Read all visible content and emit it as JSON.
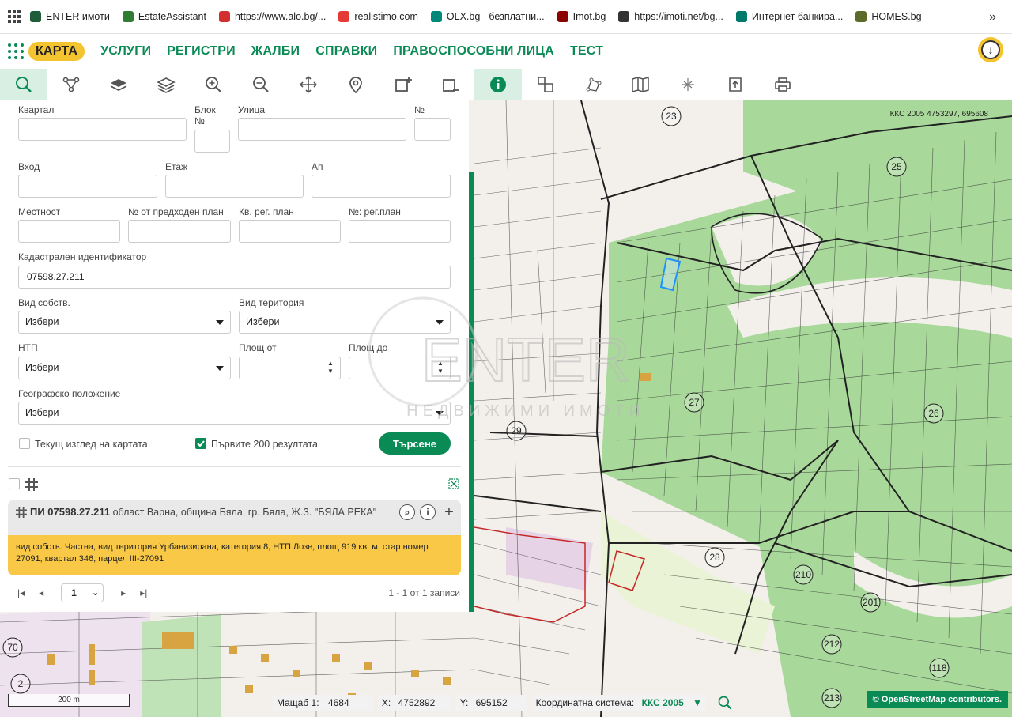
{
  "bookmarks": [
    {
      "label": "ENTER имоти",
      "color": "#1f5c3a",
      "icon": "enter-icon"
    },
    {
      "label": "EstateAssistant",
      "color": "#2e7d32",
      "icon": "estate-icon"
    },
    {
      "label": "https://www.alo.bg/...",
      "color": "#d32f2f",
      "icon": "alo-icon"
    },
    {
      "label": "realistimo.com",
      "color": "#e53935",
      "icon": "realistimo-icon"
    },
    {
      "label": "OLX.bg - безплатни...",
      "color": "#00897b",
      "icon": "olx-icon"
    },
    {
      "label": "Imot.bg",
      "color": "#8b0000",
      "icon": "imot-icon"
    },
    {
      "label": "https://imoti.net/bg...",
      "color": "#333333",
      "icon": "globe-icon"
    },
    {
      "label": "Интернет банкира...",
      "color": "#00796b",
      "icon": "bank-icon"
    },
    {
      "label": "HOMES.bg",
      "color": "#5d6b2a",
      "icon": "homes-icon"
    }
  ],
  "nav": {
    "items": [
      "КАРТА",
      "УСЛУГИ",
      "РЕГИСТРИ",
      "ЖАЛБИ",
      "СПРАВКИ",
      "ПРАВОСПОСОБНИ ЛИЦА",
      "ТЕСТ"
    ],
    "active": "КАРТА"
  },
  "toolbar": [
    "search-icon",
    "route-icon",
    "layers-icon",
    "layers-stack-icon",
    "zoom-in-icon",
    "zoom-out-icon",
    "pan-icon",
    "location-pin-icon",
    "add-area-icon",
    "remove-area-icon",
    "info-icon",
    "measure-icon",
    "polygon-icon",
    "map-icon",
    "coordinates-icon",
    "export-icon",
    "print-icon"
  ],
  "form": {
    "kvartal_label": "Квартал",
    "blok_label": "Блок\n№",
    "ulica_label": "Улица",
    "no_label": "№",
    "vhod_label": "Вход",
    "etaj_label": "Етаж",
    "ap_label": "Ап",
    "mestnost_label": "Местност",
    "prev_plan_label": "№ от предходен план",
    "kv_reg_label": "Кв. рег. план",
    "no_reg_label": "№: рег.план",
    "cad_id_label": "Кадастрален идентификатор",
    "cad_id_value": "07598.27.211",
    "vid_sobst_label": "Вид собств.",
    "vid_sobst_value": "Избери",
    "vid_ter_label": "Вид територия",
    "vid_ter_value": "Избери",
    "ntp_label": "НТП",
    "ntp_value": "Избери",
    "area_from_label": "Площ от",
    "area_to_label": "Площ до",
    "geo_label": "Географско положение",
    "geo_value": "Избери",
    "current_view_label": "Текущ изглед на картата",
    "first200_label": "Първите 200 резултата",
    "search_label": "Търсене"
  },
  "result": {
    "id": "ПИ 07598.27.211",
    "location": "област Варна, община Бяла, гр. Бяла, Ж.З. \"БЯЛА РЕКА\"",
    "details": "вид собств. Частна, вид територия Урбанизирана, категория 8, НТП Лозе, площ 919 кв. м, стар номер 27091, квартал 346, парцел III-27091"
  },
  "pager": {
    "page": "1",
    "summary": "1 - 1 от 1 записи"
  },
  "status": {
    "scale_label": "Мащаб 1:",
    "scale_value": "4684",
    "x_label": "X:",
    "x_value": "4752892",
    "y_label": "Y:",
    "y_value": "695152",
    "crs_label": "Координатна система:",
    "crs_value": "ККС 2005",
    "scalebar": "200 m",
    "attribution": "© OpenStreetMap contributors.",
    "coord_readout": "ККС 2005 4753297, 695608"
  },
  "map": {
    "labels": [
      "23",
      "25",
      "26",
      "27",
      "28",
      "29",
      "201",
      "210",
      "212",
      "213",
      "118",
      "2",
      "70"
    ]
  },
  "watermark": {
    "big": "ENTER",
    "small": "НЕДВИЖИМИ ИМОТИ"
  },
  "colors": {
    "accent": "#0a8a55",
    "highlight": "#f4c430",
    "result_body": "#f9c846",
    "green_area": "#a8d99a"
  }
}
